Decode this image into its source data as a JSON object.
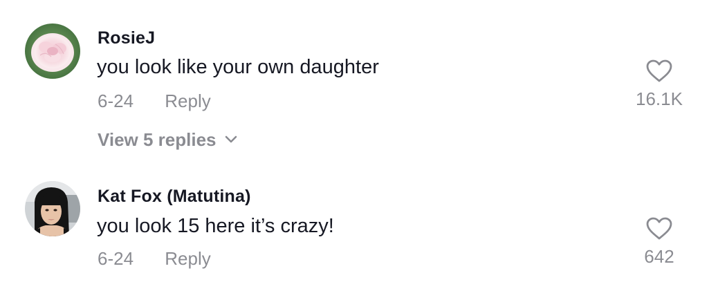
{
  "comments": [
    {
      "username": "RosieJ",
      "text": "you look like your own daughter",
      "date": "6-24",
      "reply_label": "Reply",
      "likes": "16.1K",
      "view_replies_label": "View 5 replies",
      "avatar_icon": "peony-flower-avatar"
    },
    {
      "username": "Kat Fox (Matutina)",
      "text": "you look 15 here it’s crazy!",
      "date": "6-24",
      "reply_label": "Reply",
      "likes": "642",
      "avatar_icon": "user-photo-avatar"
    }
  ],
  "icons": {
    "like": "heart-outline-icon",
    "expand": "chevron-down-icon"
  },
  "colors": {
    "text_primary": "#161823",
    "text_secondary": "#8a8b91",
    "background": "#ffffff"
  }
}
